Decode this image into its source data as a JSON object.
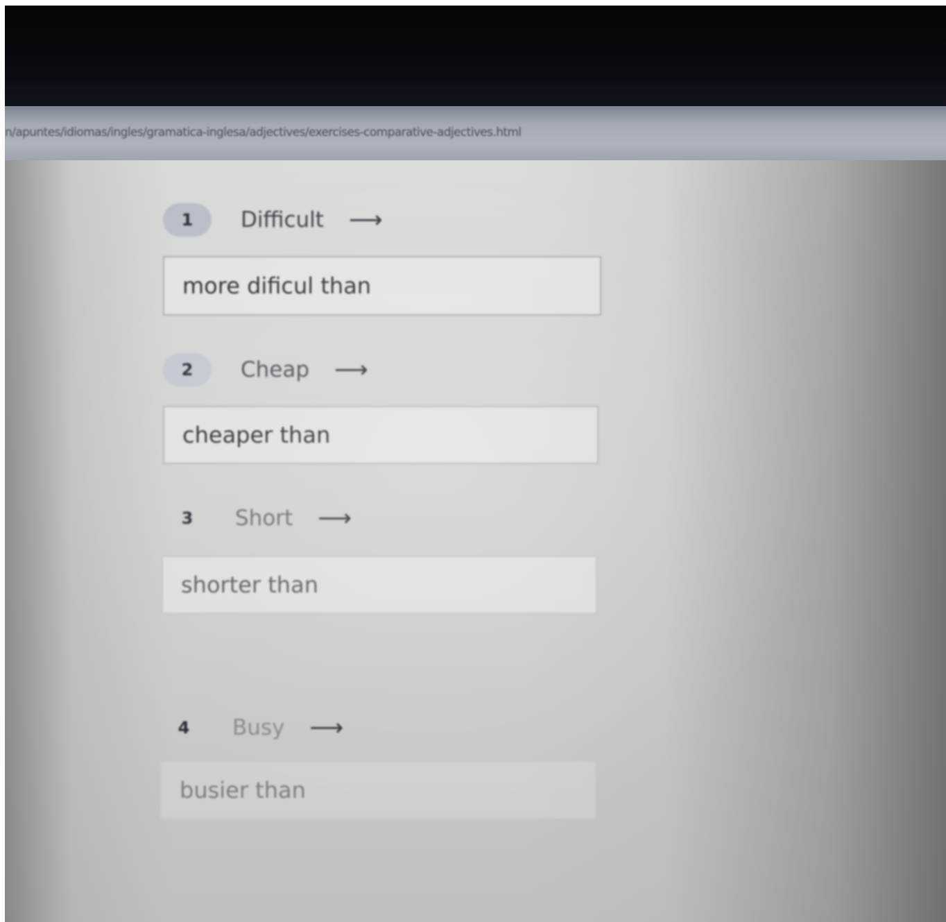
{
  "browser": {
    "url": "n/apuntes/idiomas/ingles/gramatica-inglesa/adjectives/exercises-comparative-adjectives.html"
  },
  "exercise": {
    "arrow_glyph": "⟶",
    "questions": [
      {
        "number": "1",
        "word": "Difficult",
        "answer": "more dificul than"
      },
      {
        "number": "2",
        "word": "Cheap",
        "answer": "cheaper than"
      },
      {
        "number": "3",
        "word": "Short",
        "answer": "shorter than"
      },
      {
        "number": "4",
        "word": "Busy",
        "answer": "busier than"
      }
    ]
  }
}
